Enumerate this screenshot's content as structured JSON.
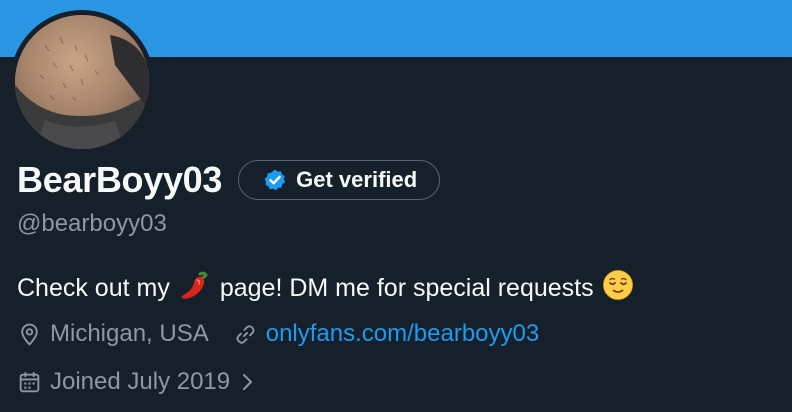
{
  "banner": {
    "color": "#2a95e2"
  },
  "profile": {
    "display_name": "BearBoyy03",
    "handle": "@bearboyy03",
    "verify_button_label": "Get verified",
    "verify_icon": "verified-badge-icon",
    "bio": {
      "text_before": "Check out my",
      "emoji_1": "hot-pepper-emoji",
      "text_middle": "page! DM me for special requests",
      "emoji_2": "relieved-face-emoji"
    },
    "location": {
      "icon": "location-pin-icon",
      "text": "Michigan, USA"
    },
    "website": {
      "icon": "link-icon",
      "text": "onlyfans.com/bearboyy03"
    },
    "joined": {
      "icon": "calendar-icon",
      "text": "Joined July 2019",
      "chevron": "chevron-right-icon"
    }
  },
  "colors": {
    "background": "#15202b",
    "primary_text": "#f7f9f9",
    "secondary_text": "#8b98a5",
    "link": "#1d9bf0",
    "verified_blue": "#1d9bf0"
  }
}
